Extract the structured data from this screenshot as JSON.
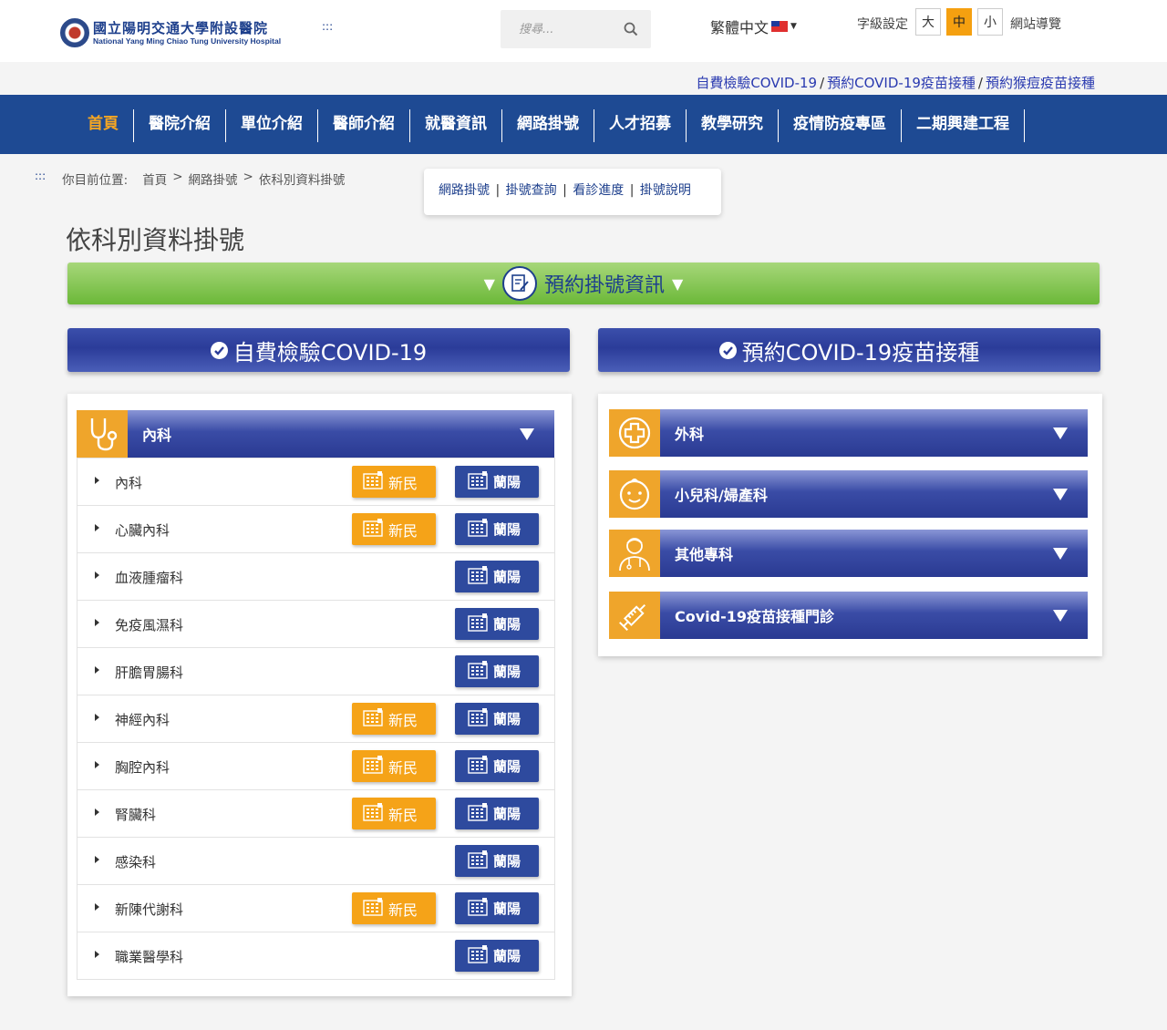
{
  "header": {
    "logo_zh": "國立陽明交通大學附設醫院",
    "logo_en": "National Yang Ming Chiao Tung University Hospital",
    "acc_key_label": ":::",
    "search_placeholder": "搜尋...",
    "language": "繁體中文",
    "font_size_label": "字級設定",
    "font_sizes": [
      "大",
      "中",
      "小"
    ],
    "font_size_active": "中",
    "sitemap": "網站導覽"
  },
  "top_links": [
    "自費檢驗COVID-19",
    "預約COVID-19疫苗接種",
    "預約猴痘疫苗接種"
  ],
  "top_links_separator": "/",
  "nav": [
    "首頁",
    "醫院介紹",
    "單位介紹",
    "醫師介紹",
    "就醫資訊",
    "網路掛號",
    "人才招募",
    "教學研究",
    "疫情防疫專區",
    "二期興建工程"
  ],
  "nav_active": "首頁",
  "breadcrumb": {
    "acc_key": ":::",
    "label": "你目前位置:",
    "items": [
      "首頁",
      "網路掛號",
      "依科別資料掛號"
    ],
    "separator": ">"
  },
  "subnav": [
    "網路掛號",
    "掛號查詢",
    "看診進度",
    "掛號說明"
  ],
  "page_title": "依科別資料掛號",
  "green_bar": {
    "label": "預約掛號資訊",
    "arrow": "▼"
  },
  "big_buttons": [
    "自費檢驗COVID-19",
    "預約COVID-19疫苗接種"
  ],
  "left_category": {
    "label": "內科",
    "icon": "stethoscope-icon"
  },
  "branch_labels": {
    "xinmin": "新民",
    "lanyang": "蘭陽"
  },
  "departments": [
    {
      "name": "內科",
      "xinmin": true
    },
    {
      "name": "心臟內科",
      "xinmin": true
    },
    {
      "name": "血液腫瘤科",
      "xinmin": false
    },
    {
      "name": "免疫風濕科",
      "xinmin": false
    },
    {
      "name": "肝膽胃腸科",
      "xinmin": false
    },
    {
      "name": "神經內科",
      "xinmin": true
    },
    {
      "name": "胸腔內科",
      "xinmin": true
    },
    {
      "name": "腎臟科",
      "xinmin": true
    },
    {
      "name": "感染科",
      "xinmin": false
    },
    {
      "name": "新陳代謝科",
      "xinmin": true
    },
    {
      "name": "職業醫學科",
      "xinmin": false
    }
  ],
  "right_categories": [
    {
      "label": "外科",
      "icon": "medical-cross-icon"
    },
    {
      "label": "小兒科/婦產科",
      "icon": "baby-face-icon"
    },
    {
      "label": "其他專科",
      "icon": "doctor-icon"
    },
    {
      "label": "Covid-19疫苗接種門診",
      "icon": "syringe-icon"
    }
  ],
  "colors": {
    "nav_blue": "#1e4a93",
    "orange": "#f5a318",
    "button_blue": "#2e4a9e",
    "green": "#6bb838",
    "active_nav": "#f5a623"
  }
}
